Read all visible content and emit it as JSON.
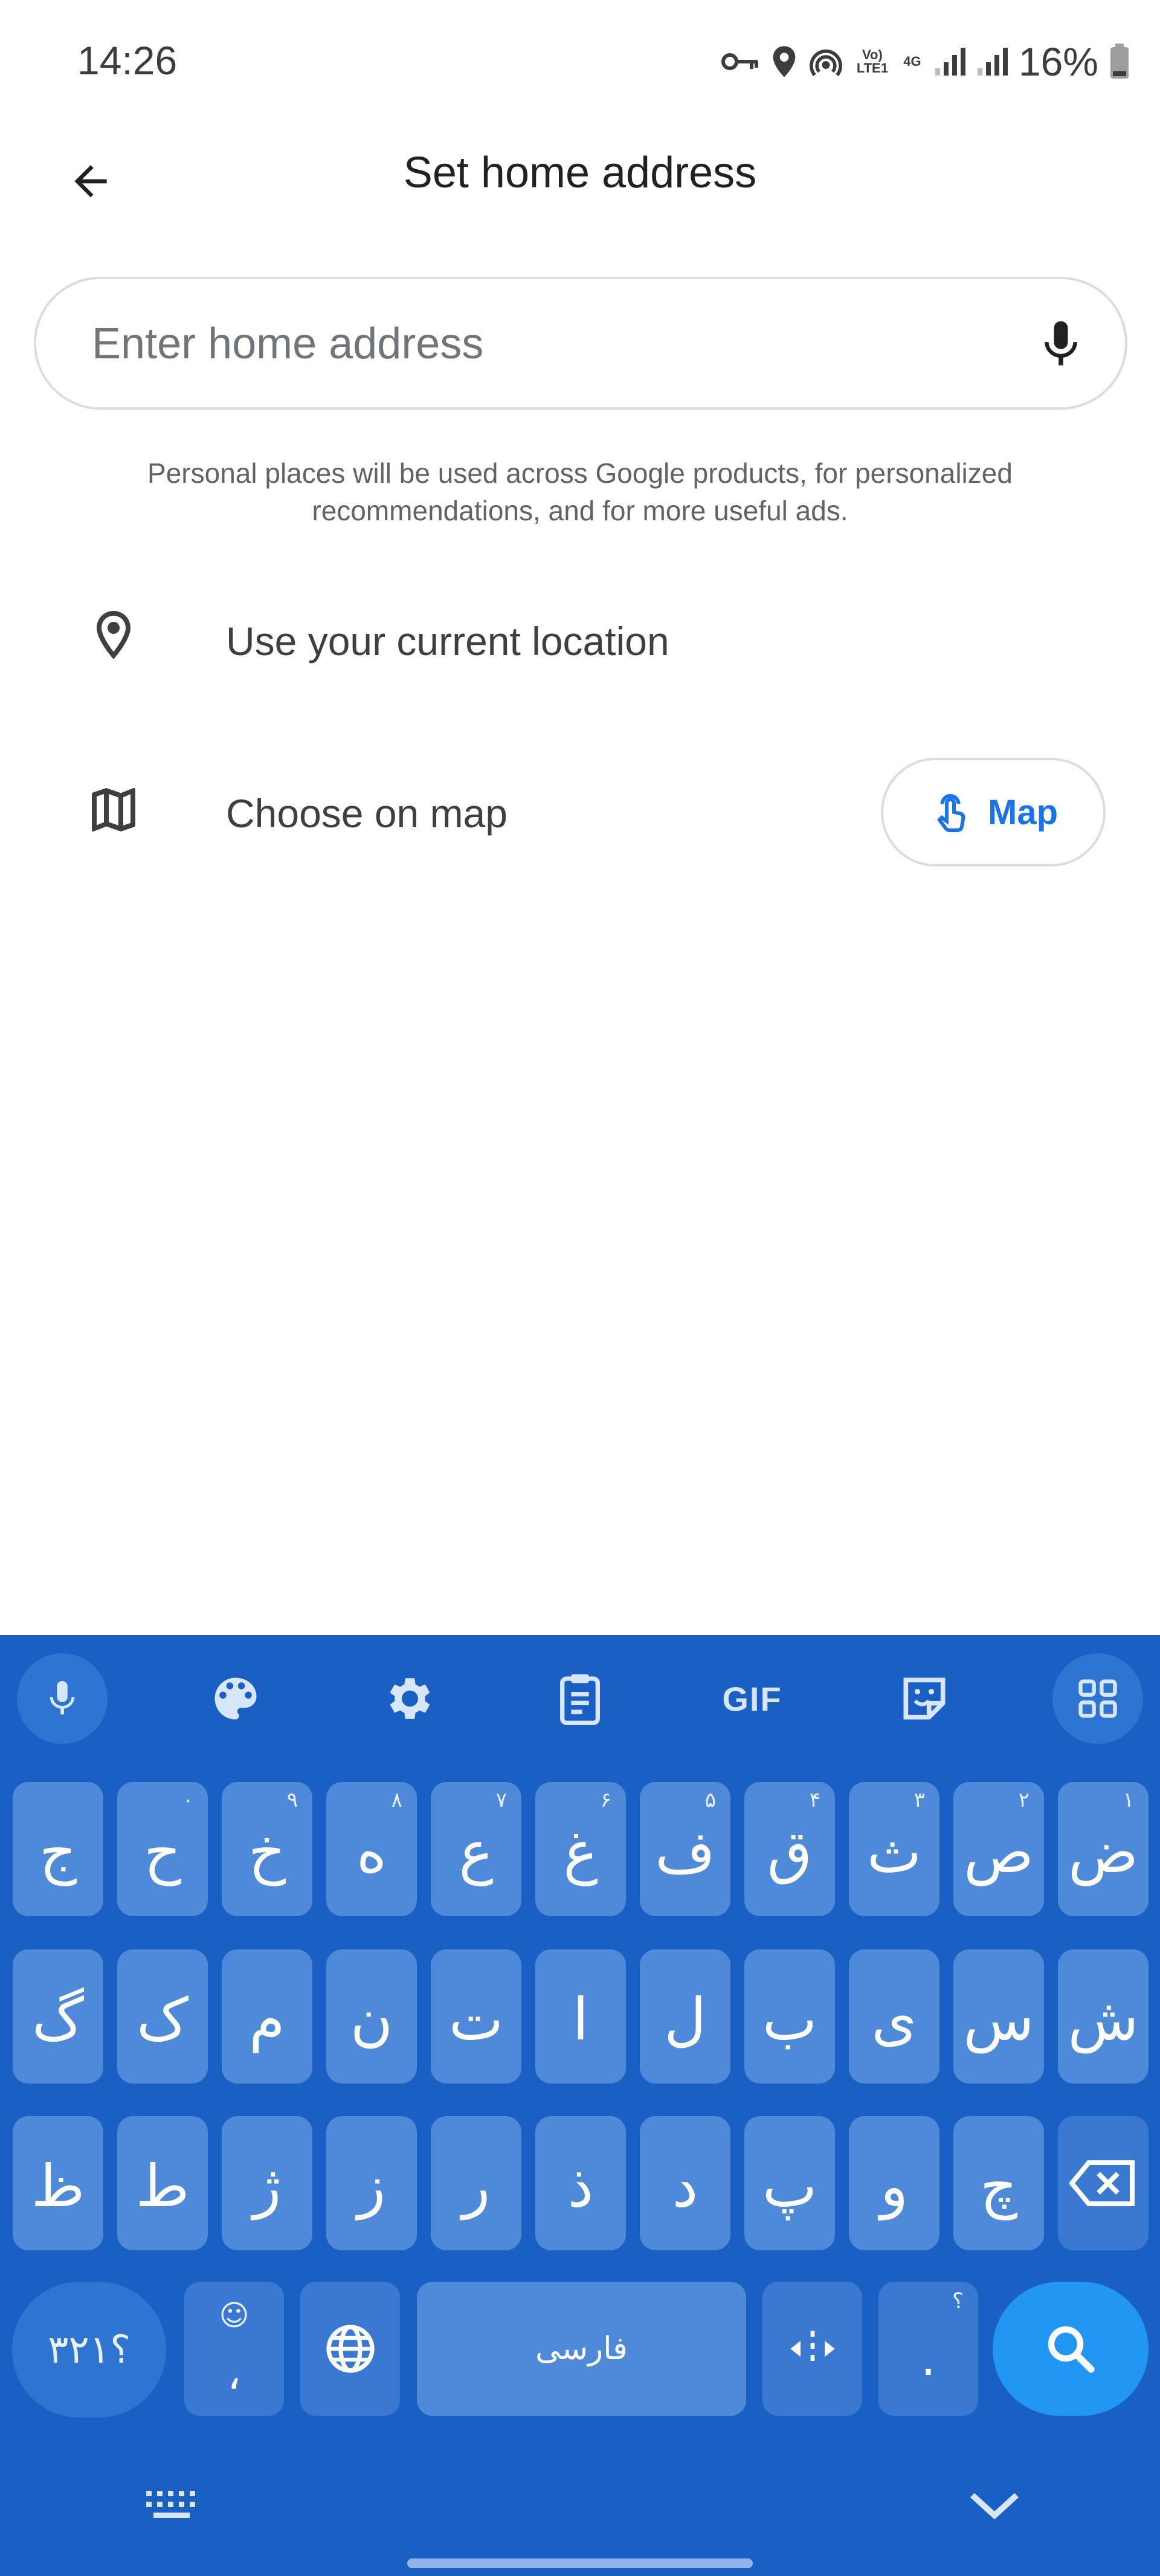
{
  "status_bar": {
    "time": "14:26",
    "network_labels": {
      "volte": "Vo) LTE1",
      "fourg": "4G"
    },
    "battery_percent": "16%"
  },
  "app_bar": {
    "title": "Set home address"
  },
  "search": {
    "placeholder": "Enter home address",
    "value": ""
  },
  "disclaimer": {
    "line1": "Personal places will be used across Google products, for personalized",
    "line2": "recommendations, and for more useful ads."
  },
  "options": {
    "current_location": "Use your current location",
    "choose_on_map": "Choose on map",
    "map_button": "Map"
  },
  "keyboard": {
    "toolbar": {
      "items": [
        "voice-input",
        "theme",
        "settings",
        "clipboard",
        "GIF",
        "sticker",
        "more"
      ],
      "gif_label": "GIF"
    },
    "rows": [
      [
        {
          "char": "ض",
          "hint": "۱"
        },
        {
          "char": "ص",
          "hint": "۲"
        },
        {
          "char": "ث",
          "hint": "۳"
        },
        {
          "char": "ق",
          "hint": "۴"
        },
        {
          "char": "ف",
          "hint": "۵"
        },
        {
          "char": "غ",
          "hint": "۶"
        },
        {
          "char": "ع",
          "hint": "۷"
        },
        {
          "char": "ه",
          "hint": "۸"
        },
        {
          "char": "خ",
          "hint": "۹"
        },
        {
          "char": "ح",
          "hint": "۰"
        },
        {
          "char": "ج",
          "hint": ""
        }
      ],
      [
        {
          "char": "ش",
          "hint": ""
        },
        {
          "char": "س",
          "hint": ""
        },
        {
          "char": "ی",
          "hint": ""
        },
        {
          "char": "ب",
          "hint": ""
        },
        {
          "char": "ل",
          "hint": ""
        },
        {
          "char": "ا",
          "hint": ""
        },
        {
          "char": "ت",
          "hint": ""
        },
        {
          "char": "ن",
          "hint": ""
        },
        {
          "char": "م",
          "hint": ""
        },
        {
          "char": "ک",
          "hint": ""
        },
        {
          "char": "گ",
          "hint": ""
        }
      ],
      [
        {
          "char": "ظ",
          "hint": ""
        },
        {
          "char": "ط",
          "hint": ""
        },
        {
          "char": "ژ",
          "hint": ""
        },
        {
          "char": "ز",
          "hint": ""
        },
        {
          "char": "ر",
          "hint": ""
        },
        {
          "char": "ذ",
          "hint": ""
        },
        {
          "char": "د",
          "hint": ""
        },
        {
          "char": "پ",
          "hint": ""
        },
        {
          "char": "و",
          "hint": ""
        },
        {
          "char": "چ",
          "hint": ""
        }
      ]
    ],
    "bottom": {
      "numbers": "؟۳۲۱",
      "comma": "،",
      "space": "فارسی",
      "period": ".",
      "period_hint": "؟"
    }
  },
  "colors": {
    "keyboard_bg": "#1a5fc4",
    "key_bg": "#4f8ad8",
    "search_key": "#2196f3",
    "accent": "#1a73e8"
  }
}
